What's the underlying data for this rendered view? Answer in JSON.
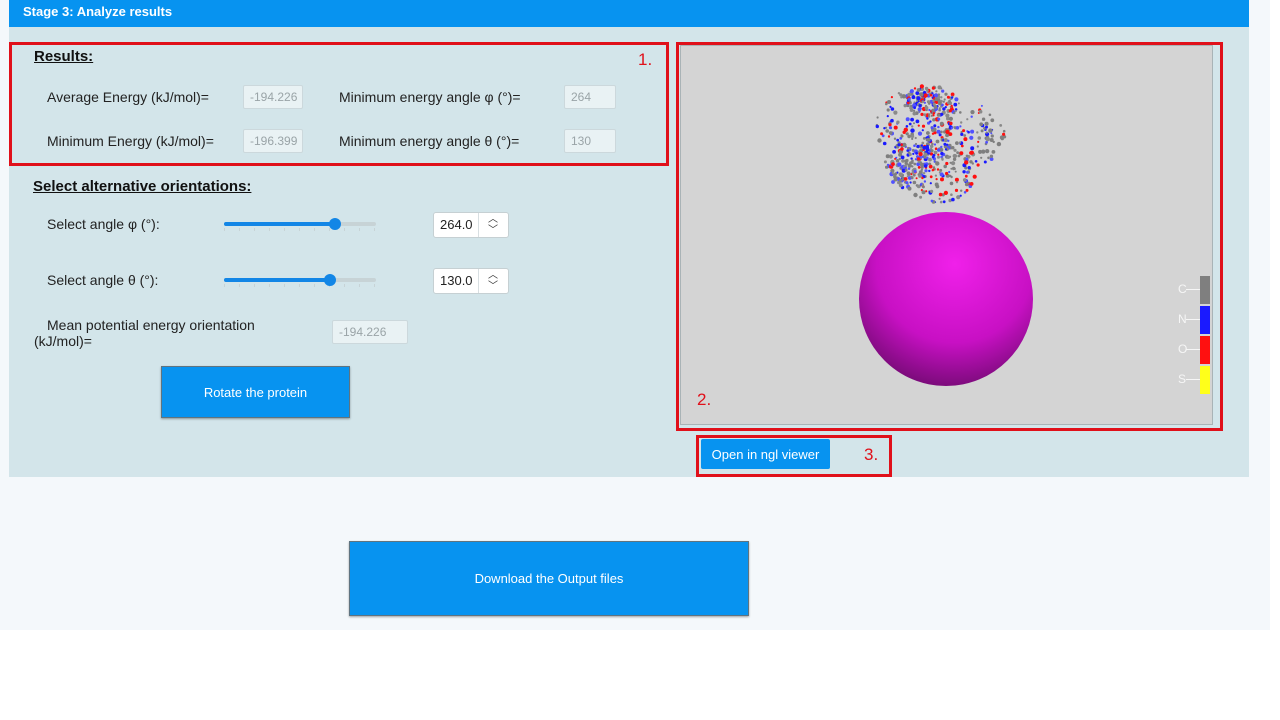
{
  "stage": {
    "title": "Stage 3: Analyze results"
  },
  "annotations": {
    "a1": "1.",
    "a2": "2.",
    "a3": "3."
  },
  "results": {
    "title": "Results:",
    "avg_energy_label": "Average Energy (kJ/mol)=",
    "avg_energy_value": "-194.226",
    "min_energy_label": "Minimum Energy (kJ/mol)=",
    "min_energy_value": "-196.399",
    "min_phi_label": "Minimum energy angle φ (°)=",
    "min_phi_value": "264",
    "min_theta_label": "Minimum energy angle θ (°)=",
    "min_theta_value": "130"
  },
  "orientation": {
    "title": "Select alternative orientations:",
    "phi_label": "Select angle φ (°):",
    "phi_value": "264.0",
    "phi_fraction": 0.733,
    "theta_label": "Select angle θ (°):",
    "theta_value": "130.0",
    "theta_fraction": 0.7,
    "mean_label_line1": "Mean potential energy orientation",
    "mean_label_line2": "(kJ/mol)=",
    "mean_value": "-194.226",
    "rotate_button": "Rotate the protein"
  },
  "viewer": {
    "legend": [
      {
        "label": "C",
        "color": "#7f7f7f"
      },
      {
        "label": "N",
        "color": "#1a1aff"
      },
      {
        "label": "O",
        "color": "#ff1010"
      },
      {
        "label": "S",
        "color": "#ffff1a"
      }
    ],
    "sphere_color": "#d010d0",
    "open_button": "Open in ngl viewer"
  },
  "download": {
    "label": "Download the Output files"
  }
}
